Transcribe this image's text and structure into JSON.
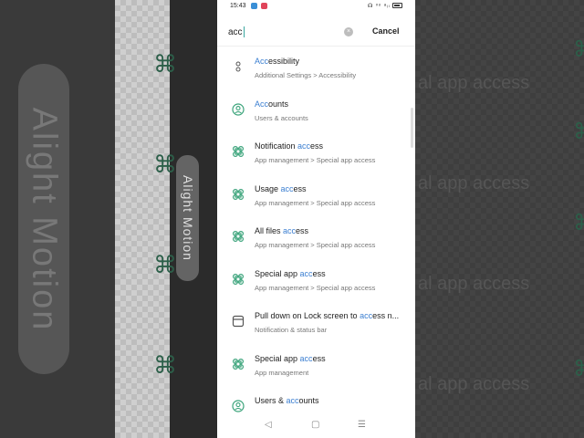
{
  "status_bar": {
    "time": "15:43",
    "icons": "☊ ᵛᵒ ᵃᵢₗ"
  },
  "search": {
    "value": "acc",
    "clear_glyph": "×",
    "cancel_label": "Cancel"
  },
  "results": [
    {
      "icon": "accessibility-icon",
      "pre": "",
      "hl": "Acc",
      "post": "essibility",
      "subtitle": "Additional Settings > Accessibility"
    },
    {
      "icon": "accounts-icon",
      "pre": "",
      "hl": "Acc",
      "post": "ounts",
      "subtitle": "Users & accounts"
    },
    {
      "icon": "app-management-icon",
      "pre": "Notification ",
      "hl": "acc",
      "post": "ess",
      "subtitle": "App management > Special app access"
    },
    {
      "icon": "app-management-icon",
      "pre": "Usage ",
      "hl": "acc",
      "post": "ess",
      "subtitle": "App management > Special app access"
    },
    {
      "icon": "app-management-icon",
      "pre": "All files ",
      "hl": "acc",
      "post": "ess",
      "subtitle": "App management > Special app access"
    },
    {
      "icon": "app-management-icon",
      "pre": "Special app ",
      "hl": "acc",
      "post": "ess",
      "subtitle": "App management > Special app access"
    },
    {
      "icon": "notification-bar-icon",
      "pre": "Pull down on Lock screen to ",
      "hl": "acc",
      "post": "ess n...",
      "subtitle": "Notification & status bar"
    },
    {
      "icon": "app-management-icon",
      "pre": "Special app ",
      "hl": "acc",
      "post": "ess",
      "subtitle": "App management"
    },
    {
      "icon": "accounts-icon",
      "pre": "Users & ",
      "hl": "acc",
      "post": "ounts",
      "subtitle": ""
    }
  ],
  "navbar": {
    "back": "◁",
    "home": "▢",
    "menu": "☰"
  },
  "watermark": {
    "text": "Alight Motion"
  },
  "background": {
    "left_text": "Alight Motion",
    "snippets": [
      "al app access",
      "al app access",
      "al app access",
      "al app access"
    ]
  },
  "colors": {
    "highlight": "#3b7fd1",
    "icon_green": "#3aa37a",
    "caret": "#3aa7a0"
  }
}
